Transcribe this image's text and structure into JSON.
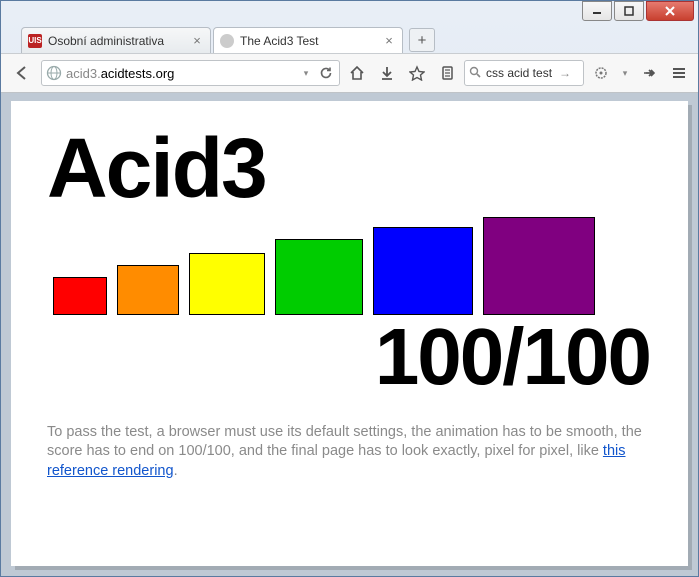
{
  "window": {
    "tabs": [
      {
        "title": "Osobní administrativa",
        "favicon": "UIS",
        "active": false
      },
      {
        "title": "The Acid3 Test",
        "favicon": "",
        "active": true
      }
    ]
  },
  "toolbar": {
    "url_prefix": "acid3.",
    "url_domain": "acidtests.org",
    "search_value": "css acid test"
  },
  "page": {
    "title": "Acid3",
    "score": "100/100",
    "instructions_text": "To pass the test, a browser must use its default settings, the animation has to be smooth, the score has to end on 100/100, and the final page has to look exactly, pixel for pixel, like ",
    "link_text": "this reference rendering",
    "period": "."
  }
}
